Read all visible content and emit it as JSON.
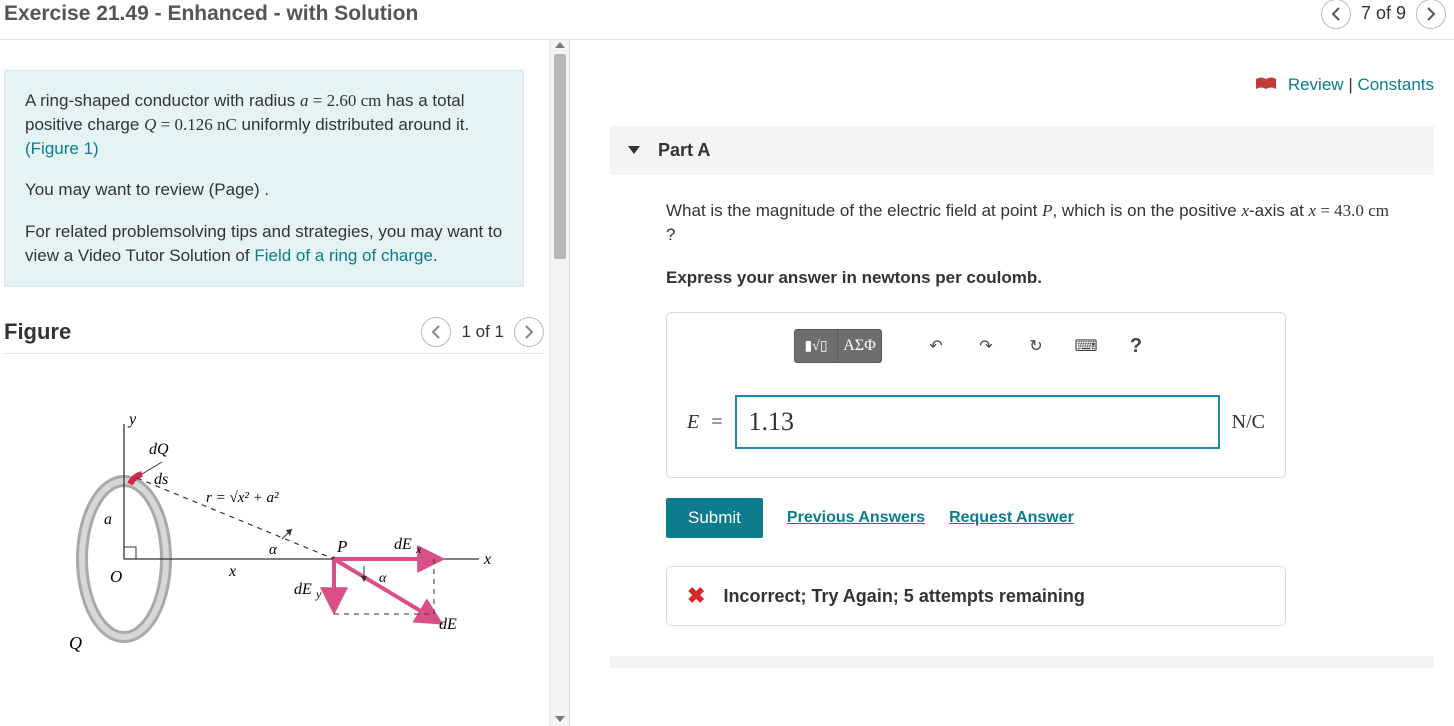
{
  "header": {
    "title": "Exercise 21.49 - Enhanced - with Solution",
    "position": "7 of 9"
  },
  "problem": {
    "p1_a": "A ring-shaped conductor with radius ",
    "p1_var_a": "a",
    "p1_eq1": " = 2.60 ",
    "p1_unit1": "cm",
    "p1_b": " has a total positive charge ",
    "p1_var_Q": "Q",
    "p1_eq2": " = 0.126 ",
    "p1_unit2": "nC",
    "p1_c": " uniformly distributed around it.",
    "p1_figref": "(Figure 1)",
    "p2": "You may want to review (Page) .",
    "p3_a": "For related problemsolving tips and strategies, you may want to view a Video Tutor Solution of ",
    "p3_link": "Field of a ring of charge",
    "p3_b": "."
  },
  "figure": {
    "title": "Figure",
    "position": "1 of 1"
  },
  "toplinks": {
    "review": "Review",
    "constants": "Constants"
  },
  "partA": {
    "label": "Part A",
    "q_a": "What is the magnitude of the electric field at point ",
    "q_P": "P",
    "q_b": ", which is on the positive ",
    "q_xaxis": "x",
    "q_c": "-axis at ",
    "q_xvar": "x",
    "q_d": " = 43.0 ",
    "q_unit": "cm",
    "q_e": " ?",
    "instruct": "Express your answer in newtons per coulomb.",
    "answer_symbol": "E",
    "answer_eq": "=",
    "answer_value": "1.13",
    "answer_unit": "N/C",
    "submit": "Submit",
    "prev": "Previous Answers",
    "req": "Request Answer",
    "feedback": "Incorrect; Try Again; 5 attempts remaining"
  },
  "toolbar": {
    "templates": "▮√▯",
    "greek": "ΑΣΦ",
    "undo_icon": "↶",
    "redo_icon": "↷",
    "reset_icon": "↻",
    "keyboard_icon": "⌨",
    "help_icon": "?"
  }
}
